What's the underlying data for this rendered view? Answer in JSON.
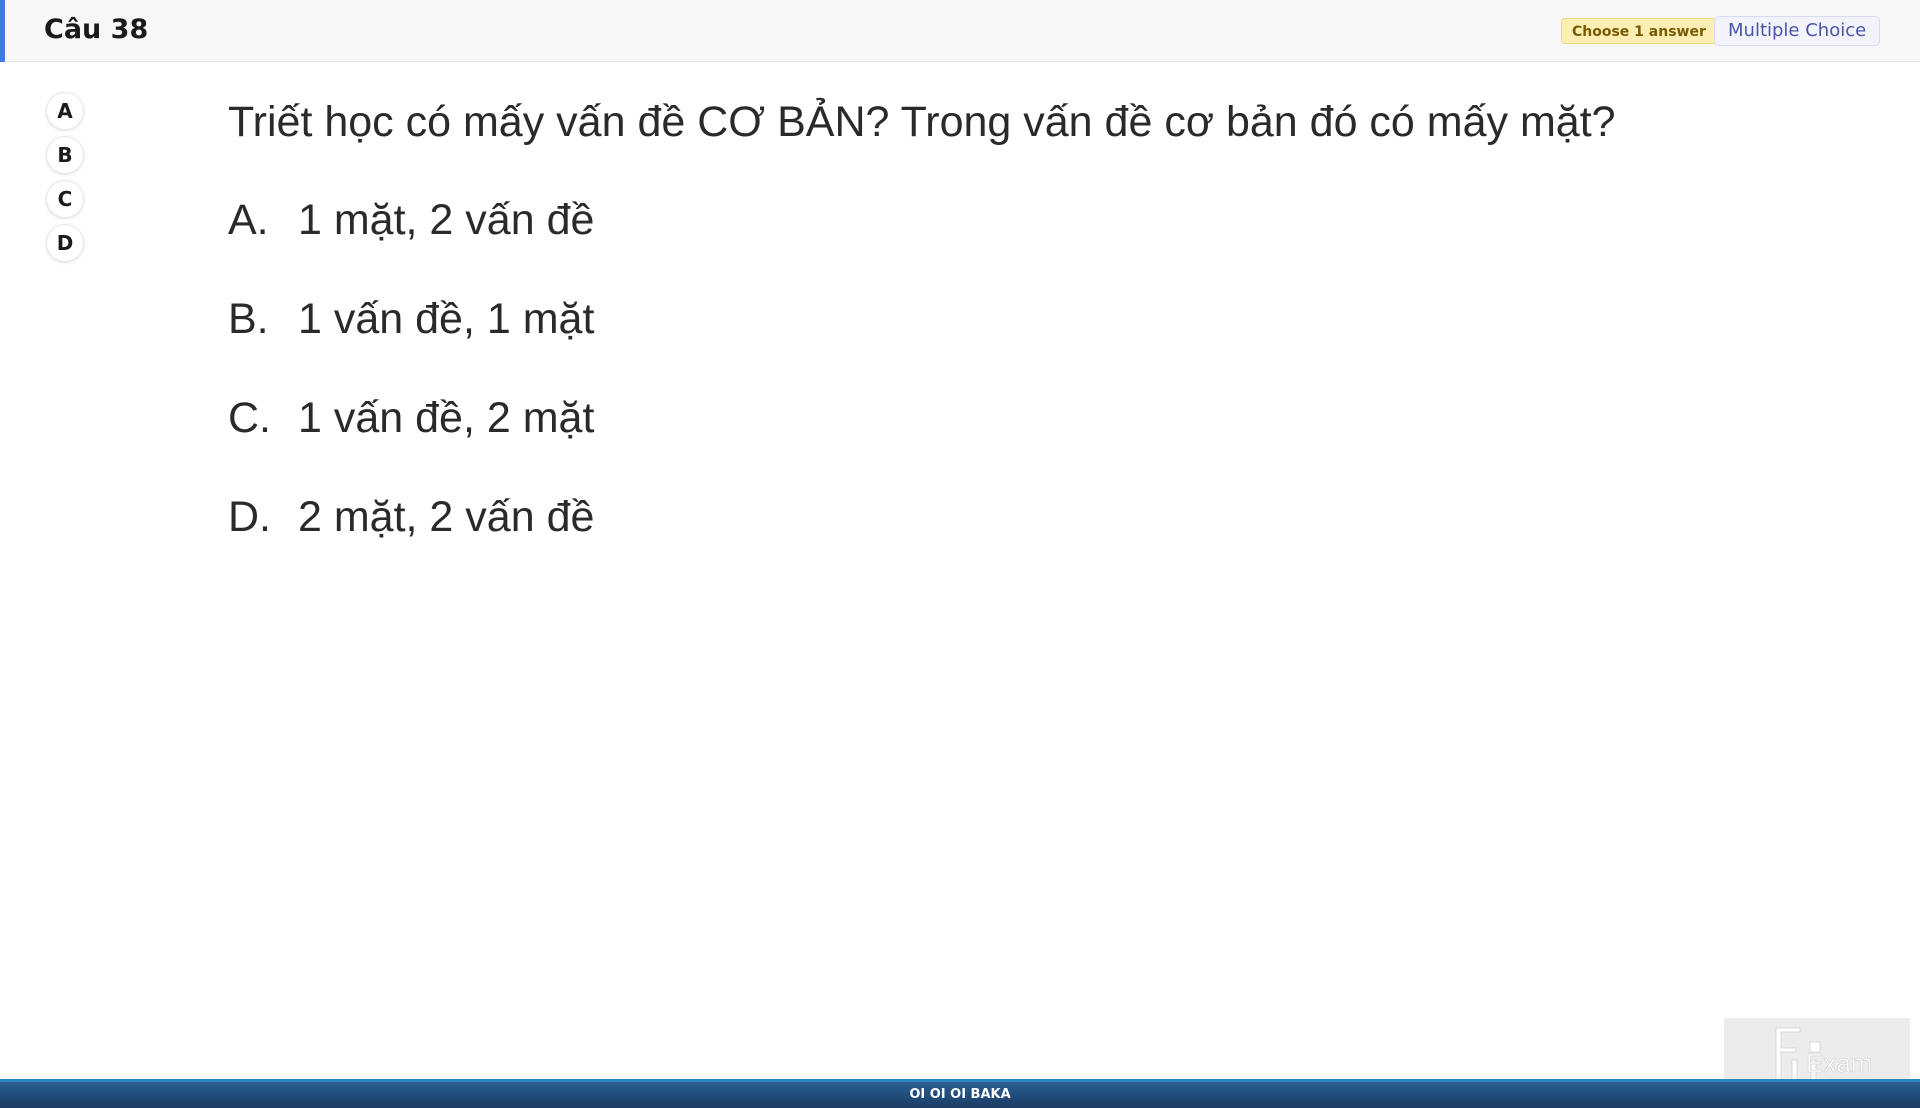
{
  "header": {
    "title": "Câu 38",
    "badge_choose": "Choose 1 answer",
    "badge_type": "Multiple Choice",
    "accent_color": "#3d7be0"
  },
  "option_buttons": [
    "A",
    "B",
    "C",
    "D"
  ],
  "question": {
    "text": "Triết học có mấy vấn đề CƠ BẢN? Trong vấn đề cơ bản đó có mấy mặt?",
    "answers": [
      {
        "letter": "A.",
        "text": "1 mặt, 2 vấn đề"
      },
      {
        "letter": "B.",
        "text": "1 vấn đề, 1 mặt"
      },
      {
        "letter": "C.",
        "text": "1 vấn đề, 2 mặt"
      },
      {
        "letter": "D.",
        "text": "2 mặt, 2 vấn đề"
      }
    ]
  },
  "logo": {
    "text": "Exam",
    "icon": "fu-exam-logo-icon"
  },
  "footer": {
    "text": "OI OI OI BAKA"
  }
}
